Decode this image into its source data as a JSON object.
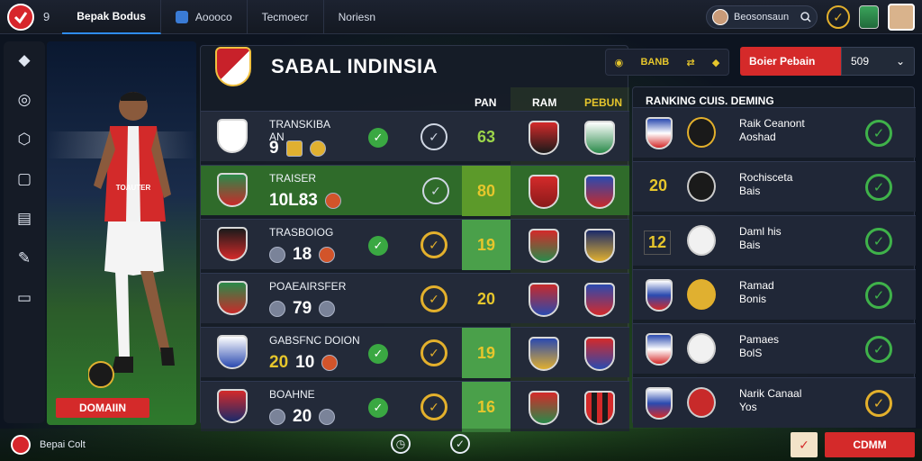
{
  "topbar": {
    "count": "9",
    "tabs": [
      {
        "label": "Bepak Bodus",
        "active": true
      },
      {
        "label": "Aoooco",
        "active": false
      },
      {
        "label": "Tecmoecr",
        "active": false
      },
      {
        "label": "Noriesn",
        "active": false
      }
    ],
    "search_label": "Beosonsaun"
  },
  "sidebar_icons": [
    "diamond-icon",
    "target-icon",
    "cube-icon",
    "chat-icon",
    "book-icon",
    "pen-icon",
    "monitor-icon"
  ],
  "player_card": {
    "button_label": "DOMAIIN",
    "shirt_text": "TOAUTER"
  },
  "main": {
    "title": "SABAL INDINSIA",
    "col_pan": "PAN",
    "col_ram": "RAM",
    "col_pebun": "PEBUN",
    "rows": [
      {
        "name": "TRANSKIBA\nAN",
        "num": "9",
        "score": "63",
        "style": "plain",
        "check": "white"
      },
      {
        "name": "TRAISER",
        "num": "10L83",
        "score": "80",
        "style": "hl",
        "check": "ok"
      },
      {
        "name": "TRASBOIOG",
        "num": "18",
        "score": "19",
        "style": "green",
        "check": "gold"
      },
      {
        "name": "POAEAIRSFER",
        "num": "79",
        "score": "20",
        "style": "plain",
        "check": "gold"
      },
      {
        "name": "GABSFNC DOION",
        "num": "10",
        "score": "19",
        "style": "green",
        "check": "gold"
      },
      {
        "name": "BOAHNE",
        "num": "20",
        "score": "16",
        "style": "green",
        "check": "gold"
      }
    ]
  },
  "toolbar": {
    "label": "BANB"
  },
  "dropdown": {
    "red_label": "Boier Pebain",
    "value": "509"
  },
  "ranking": {
    "title": "RANKING CUIS. DEMING",
    "rows": [
      {
        "num": "",
        "name": "Raik Ceanont\nAoshad",
        "check": "green"
      },
      {
        "num": "20",
        "name": "Rochisceta\nBais",
        "check": "green"
      },
      {
        "num": "12",
        "name": "Daml his\nBais",
        "check": "green"
      },
      {
        "num": "",
        "name": "Ramad\nBonis",
        "check": "green"
      },
      {
        "num": "",
        "name": "Pamaes\nBolS",
        "check": "green"
      },
      {
        "num": "",
        "name": "Narik Canaal\nYos",
        "check": "gold"
      }
    ]
  },
  "bottombar": {
    "text": "Bepai Colt",
    "confirm_label": "CDMM"
  }
}
